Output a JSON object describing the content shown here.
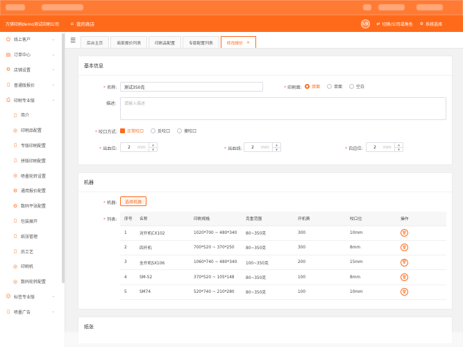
{
  "topbar": {
    "company": "万骐印刷demo测试印刷公司",
    "shop": "我的商店",
    "avatar": "头像",
    "switch_label": "切换/公司或角色",
    "system_label": "系统选择"
  },
  "sidebar": {
    "items": [
      {
        "label": "线上客户",
        "icon": "user-icon",
        "type": "group"
      },
      {
        "label": "订单中心",
        "icon": "order-icon",
        "type": "group"
      },
      {
        "label": "店铺设置",
        "icon": "gear-icon",
        "type": "group"
      },
      {
        "label": "普通版报价",
        "icon": "doc-icon",
        "type": "group"
      },
      {
        "label": "印刷专业版",
        "icon": "print-icon",
        "type": "group"
      },
      {
        "label": "简介",
        "icon": "doc-icon",
        "type": "sub"
      },
      {
        "label": "印刷品配置",
        "icon": "circle-icon",
        "type": "sub"
      },
      {
        "label": "专版印刷配置",
        "icon": "doc-icon",
        "type": "sub"
      },
      {
        "label": "拼版印刷配置",
        "icon": "doc-icon",
        "type": "sub"
      },
      {
        "label": "喷墨轮转设置",
        "icon": "circle-icon",
        "type": "sub"
      },
      {
        "label": "通用报价配置",
        "icon": "gear-icon",
        "type": "sub"
      },
      {
        "label": "数码平张配置",
        "icon": "gear-icon",
        "type": "sub"
      },
      {
        "label": "包装展开",
        "icon": "doc-icon",
        "type": "sub"
      },
      {
        "label": "纸张管理",
        "icon": "doc-icon",
        "type": "sub"
      },
      {
        "label": "后工艺",
        "icon": "doc-icon",
        "type": "sub"
      },
      {
        "label": "印刷机",
        "icon": "circle-icon",
        "type": "sub"
      },
      {
        "label": "数码轮转配置",
        "icon": "circle-icon",
        "type": "sub"
      },
      {
        "label": "标签专业版",
        "icon": "user-icon",
        "type": "group"
      },
      {
        "label": "喷墨广告",
        "icon": "doc-icon",
        "type": "group"
      }
    ]
  },
  "tabs": [
    {
      "label": "后台主页",
      "active": false
    },
    {
      "label": "商家报价列表",
      "active": false
    },
    {
      "label": "印刷品配置",
      "active": false
    },
    {
      "label": "专版配置列表",
      "active": false
    },
    {
      "label": "修改报价",
      "active": true
    }
  ],
  "basic": {
    "title": "基本信息",
    "name_label": "名称:",
    "name_value": "测试350克",
    "side_label": "印刷面:",
    "side_options": [
      "双面",
      "单面",
      "空白"
    ],
    "side_selected": 0,
    "desc_label": "描述:",
    "desc_placeholder": "请输入描述",
    "bite_label": "咬口方式:",
    "bite_options": [
      "正常咬口",
      "反咬口",
      "傻咬口"
    ],
    "bite_checked": [
      true,
      false,
      false
    ],
    "bleed_pos_label": "出血位:",
    "bleed_pos_value": "2",
    "bleed_line_label": "出血线:",
    "bleed_line_value": "2",
    "white_label": "白边位:",
    "white_value": "2",
    "unit": "mm"
  },
  "machines": {
    "title": "机器",
    "machine_label": "机器:",
    "select_button": "选择机器",
    "list_label": "列表:",
    "columns": [
      "序号",
      "名称",
      "印刷规格",
      "克重范围",
      "开机费",
      "咬口位",
      "操作"
    ],
    "rows": [
      [
        "1",
        "对开机CX102",
        "1020*700 ~ 480*340",
        "80~350克",
        "300",
        "10mm"
      ],
      [
        "2",
        "四开机",
        "700*520 ~ 370*250",
        "80~350克",
        "300",
        "8mm"
      ],
      [
        "3",
        "全开机SX106",
        "1060*740 ~ 480*340",
        "100~350克",
        "200",
        "15mm"
      ],
      [
        "4",
        "SM-52",
        "370*520 ~ 105*148",
        "80~350克",
        "100",
        "8mm"
      ],
      [
        "5",
        "SM74",
        "520*740 ~ 210*280",
        "80~350克",
        "100",
        "10mm"
      ]
    ]
  },
  "paper": {
    "title": "纸张"
  },
  "colors": {
    "accent": "#ff6a1a"
  }
}
